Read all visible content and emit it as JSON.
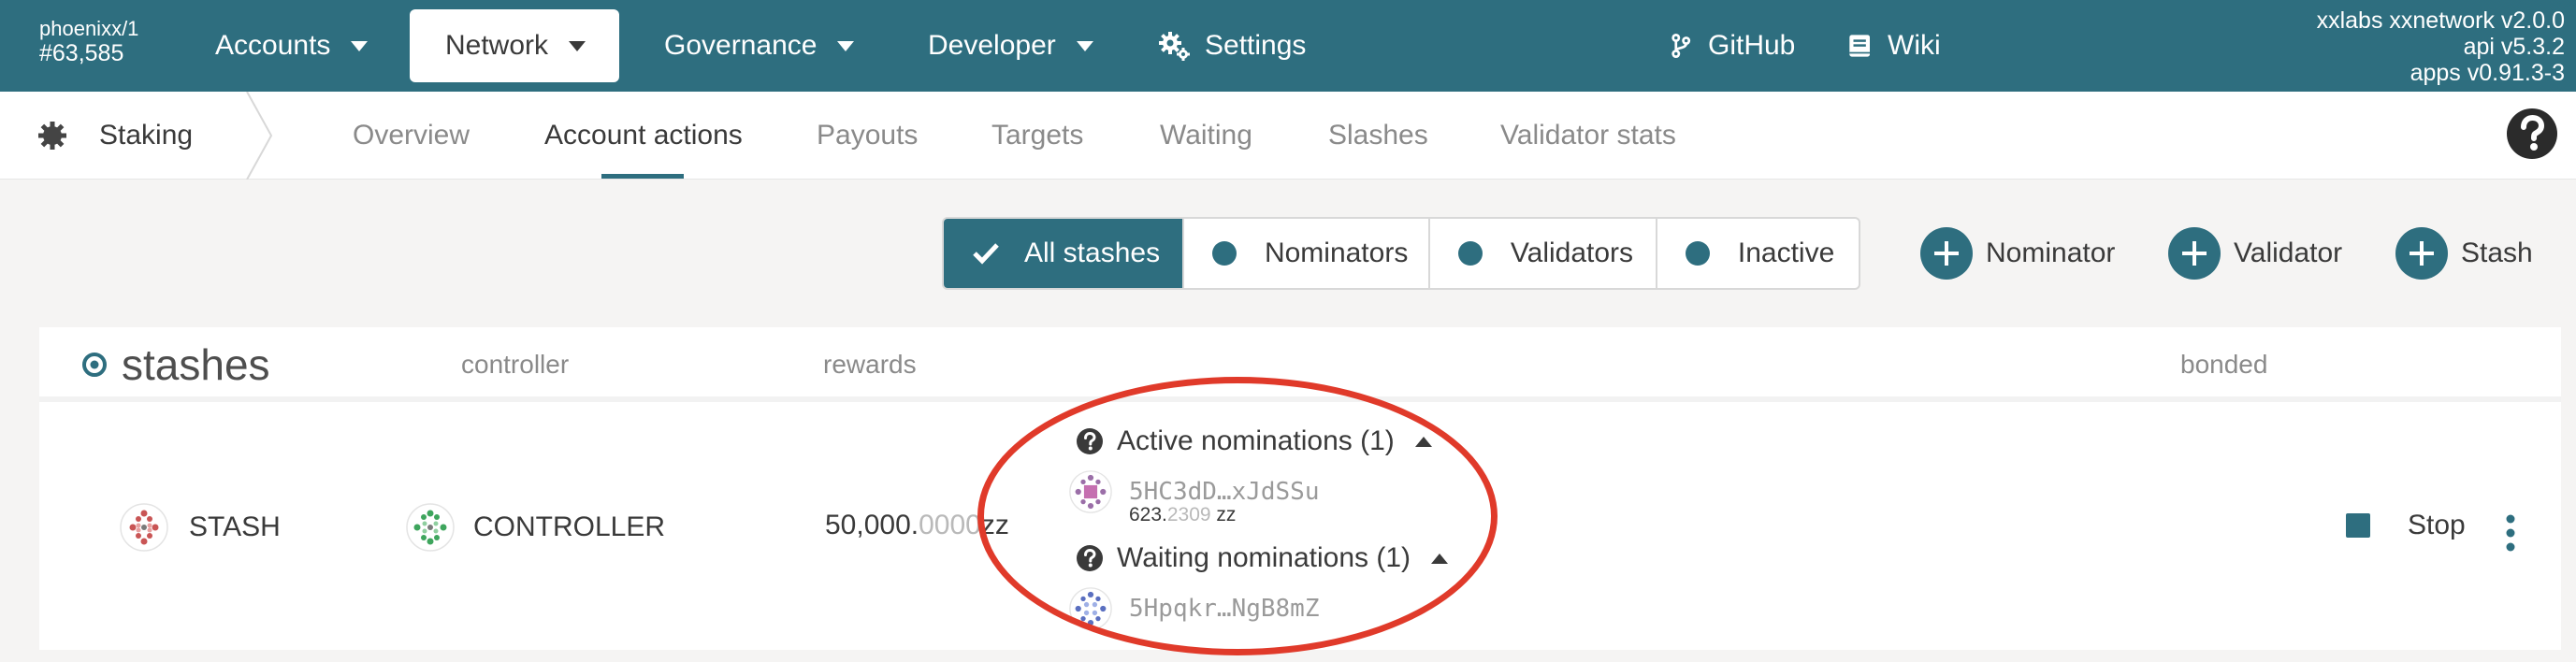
{
  "topbar": {
    "chain": "phoenixx/1",
    "block": "#63,585",
    "nav": {
      "accounts": "Accounts",
      "network": "Network",
      "governance": "Governance",
      "developer": "Developer",
      "settings": "Settings",
      "github": "GitHub",
      "wiki": "Wiki"
    },
    "version": {
      "node": "xxlabs xxnetwork v2.0.0",
      "api": "api v5.3.2",
      "apps": "apps v0.91.3-3"
    }
  },
  "tabbar": {
    "section": "Staking",
    "tabs": {
      "overview": "Overview",
      "account_actions": "Account actions",
      "payouts": "Payouts",
      "targets": "Targets",
      "waiting": "Waiting",
      "slashes": "Slashes",
      "validator_stats": "Validator stats"
    }
  },
  "filters": {
    "all_stashes": "All stashes",
    "nominators": "Nominators",
    "validators": "Validators",
    "inactive": "Inactive"
  },
  "actions": {
    "nominator": "Nominator",
    "validator": "Validator",
    "stash": "Stash"
  },
  "table": {
    "headers": {
      "stashes": "stashes",
      "controller": "controller",
      "rewards": "rewards",
      "bonded": "bonded"
    },
    "row": {
      "stash": "STASH",
      "controller": "CONTROLLER",
      "rewards_int": "50,000.",
      "rewards_dec": "0000",
      "rewards_unit": " zz",
      "active_title": "Active nominations (1)",
      "active_addr": "5HC3dD…xJdSSu",
      "active_amount_int": "623.",
      "active_amount_dec": "2309",
      "active_amount_unit": " zz",
      "waiting_title": "Waiting nominations (1)",
      "waiting_addr": "5Hpqkr…NgB8mZ",
      "stop": "Stop"
    }
  },
  "colors": {
    "brand": "#2e6e7f",
    "annotation": "#e03a2a"
  }
}
